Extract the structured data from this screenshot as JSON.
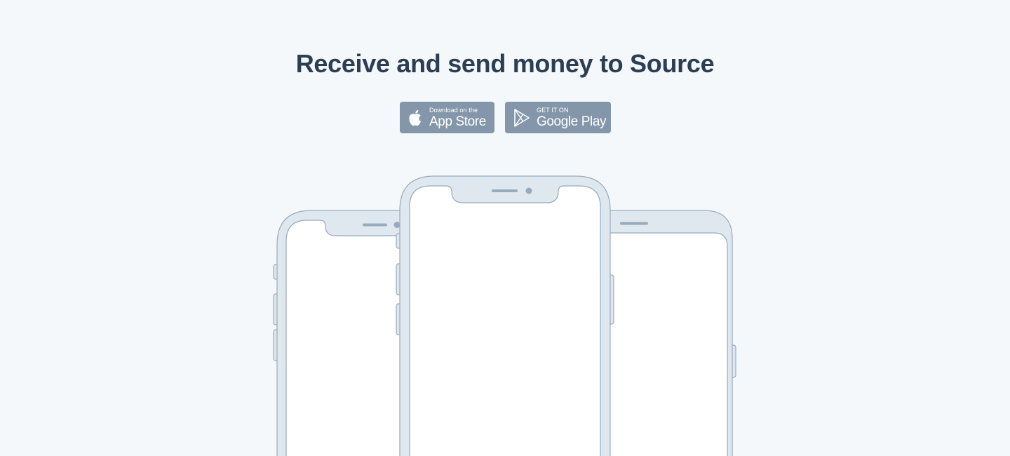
{
  "headline": "Receive and send money to Source",
  "badges": {
    "appstore": {
      "icon": "apple-icon",
      "small": "Download on the",
      "large": "App Store"
    },
    "googleplay": {
      "icon": "google-play-icon",
      "small": "GET IT ON",
      "large": "Google Play"
    }
  },
  "colors": {
    "background": "#f4f8fb",
    "headline": "#2c3e53",
    "badge": "#8497aa",
    "phone_frame": "#dfe7ef",
    "phone_outline": "#98abbd",
    "screen": "#ffffff"
  }
}
